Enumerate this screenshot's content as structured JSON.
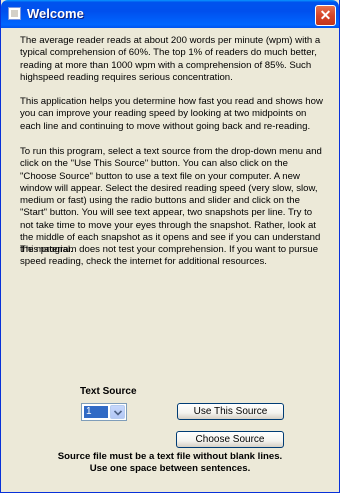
{
  "window": {
    "title": "Welcome",
    "close_glyph": "✕"
  },
  "body": {
    "paragraphs": [
      "The average reader reads at about 200 words per minute (wpm) with a typical comprehension of 60%.  The top 1% of readers do much better, reading at more than 1000 wpm with a comprehension of 85%.  Such highspeed reading requires serious concentration.",
      "This application helps you determine how fast you read and shows how you can improve your reading speed by looking at two midpoints on each line and continuing to move without going back and re-reading.",
      "To run this program, select a text source from the drop-down menu and click on the \"Use This Source\" button.   You can also click on the \"Choose Source\" button to use a text file on your computer.  A new window will appear.  Select the desired reading speed (very slow, slow, medium or fast) using the radio buttons and slider and click on the \"Start\" button.  You will see text appear, two snapshots per line.  Try to not take time to move your eyes through the snapshot.  Rather, look at the middle of each snapshot as it opens and see if you can understand the material.",
      "This program does not test your comprehension.  If you want to pursue speed reading, check the internet for additional resources."
    ]
  },
  "source": {
    "label": "Text Source",
    "selected_value": "1",
    "dropdown_icon": "chevron-down-icon",
    "use_button": "Use This Source",
    "choose_button": "Choose Source"
  },
  "notes": {
    "line1": "Source file must be a text file without blank lines.",
    "line2": "Use one space between sentences."
  },
  "colors": {
    "titlebar": "#0053ee",
    "window_bg": "#ece9d8",
    "selection": "#316ac5",
    "close_button": "#d6452a"
  }
}
